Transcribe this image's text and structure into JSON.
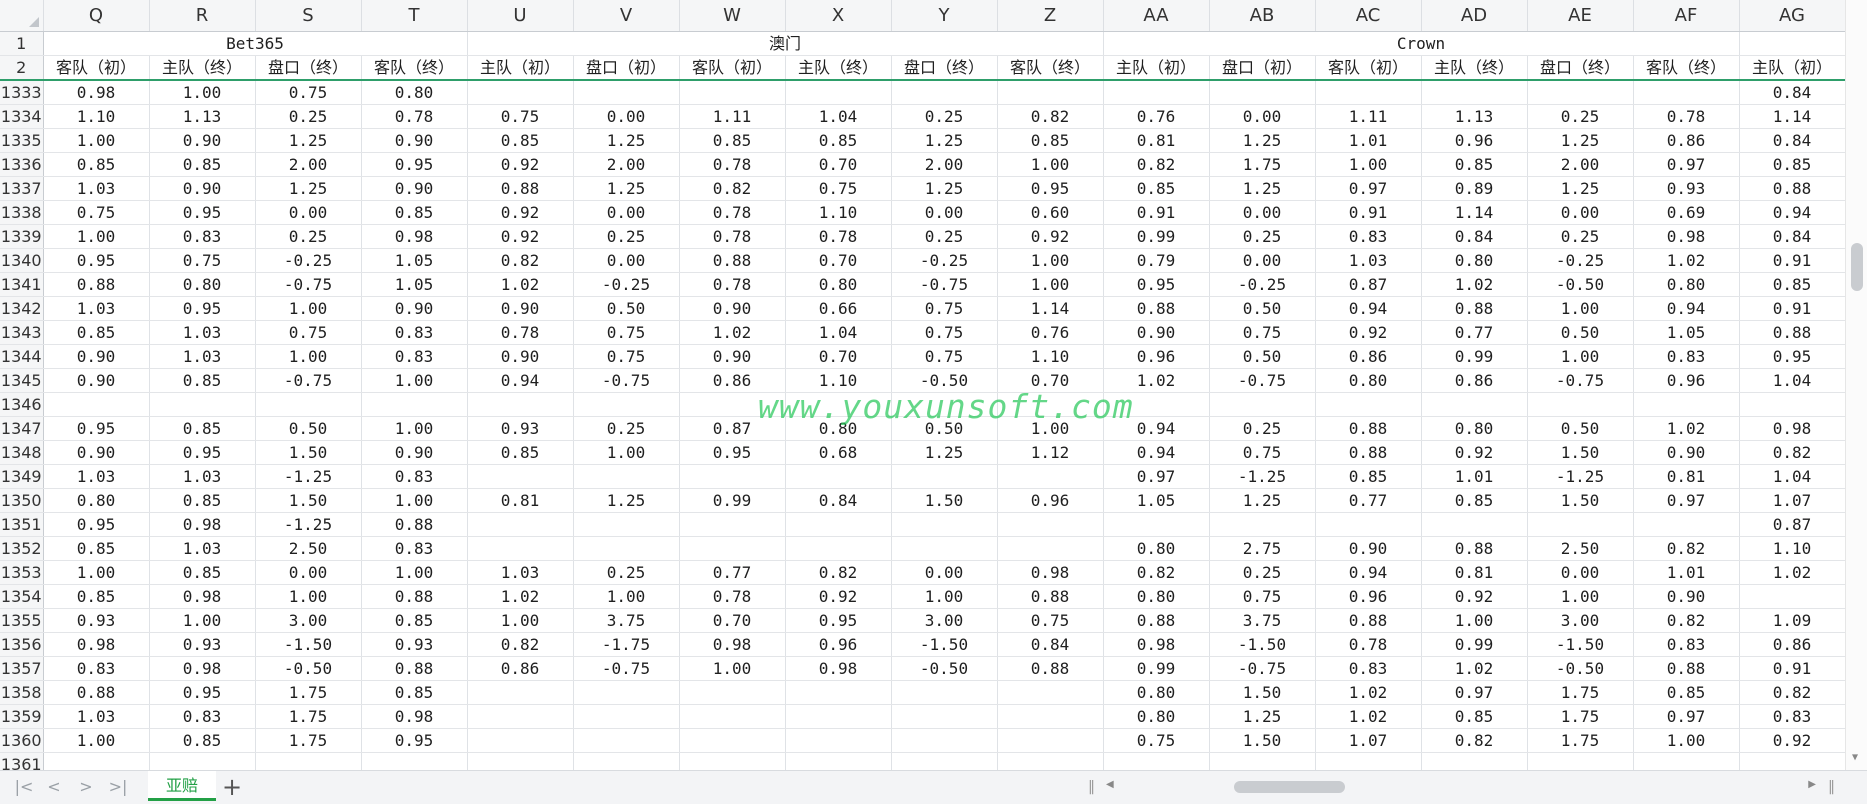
{
  "columns": [
    "Q",
    "R",
    "S",
    "T",
    "U",
    "V",
    "W",
    "X",
    "Y",
    "Z",
    "AA",
    "AB",
    "AC",
    "AD",
    "AE",
    "AF",
    "AG"
  ],
  "group_headers": [
    {
      "label": "Bet365",
      "span": 4
    },
    {
      "label": "澳门",
      "span": 6
    },
    {
      "label": "Crown",
      "span": 6
    },
    {
      "label": "",
      "span": 1
    }
  ],
  "header_row_labels": [
    "1",
    "2"
  ],
  "subheaders": [
    "客队（初）",
    "主队（终）",
    "盘口（终）",
    "客队（终）",
    "主队（初）",
    "盘口（初）",
    "客队（初）",
    "主队（终）",
    "盘口（终）",
    "客队（终）",
    "主队（初）",
    "盘口（初）",
    "客队（初）",
    "主队（终）",
    "盘口（终）",
    "客队（终）",
    "主队（初）"
  ],
  "rows": [
    {
      "n": "1333",
      "c": [
        "0.98",
        "1.00",
        "0.75",
        "0.80",
        "",
        "",
        "",
        "",
        "",
        "",
        "",
        "",
        "",
        "",
        "",
        "",
        "0.84"
      ]
    },
    {
      "n": "1334",
      "c": [
        "1.10",
        "1.13",
        "0.25",
        "0.78",
        "0.75",
        "0.00",
        "1.11",
        "1.04",
        "0.25",
        "0.82",
        "0.76",
        "0.00",
        "1.11",
        "1.13",
        "0.25",
        "0.78",
        "1.14"
      ]
    },
    {
      "n": "1335",
      "c": [
        "1.00",
        "0.90",
        "1.25",
        "0.90",
        "0.85",
        "1.25",
        "0.85",
        "0.85",
        "1.25",
        "0.85",
        "0.81",
        "1.25",
        "1.01",
        "0.96",
        "1.25",
        "0.86",
        "0.84"
      ]
    },
    {
      "n": "1336",
      "c": [
        "0.85",
        "0.85",
        "2.00",
        "0.95",
        "0.92",
        "2.00",
        "0.78",
        "0.70",
        "2.00",
        "1.00",
        "0.82",
        "1.75",
        "1.00",
        "0.85",
        "2.00",
        "0.97",
        "0.85"
      ]
    },
    {
      "n": "1337",
      "c": [
        "1.03",
        "0.90",
        "1.25",
        "0.90",
        "0.88",
        "1.25",
        "0.82",
        "0.75",
        "1.25",
        "0.95",
        "0.85",
        "1.25",
        "0.97",
        "0.89",
        "1.25",
        "0.93",
        "0.88"
      ]
    },
    {
      "n": "1338",
      "c": [
        "0.75",
        "0.95",
        "0.00",
        "0.85",
        "0.92",
        "0.00",
        "0.78",
        "1.10",
        "0.00",
        "0.60",
        "0.91",
        "0.00",
        "0.91",
        "1.14",
        "0.00",
        "0.69",
        "0.94"
      ]
    },
    {
      "n": "1339",
      "c": [
        "1.00",
        "0.83",
        "0.25",
        "0.98",
        "0.92",
        "0.25",
        "0.78",
        "0.78",
        "0.25",
        "0.92",
        "0.99",
        "0.25",
        "0.83",
        "0.84",
        "0.25",
        "0.98",
        "0.84"
      ]
    },
    {
      "n": "1340",
      "c": [
        "0.95",
        "0.75",
        "-0.25",
        "1.05",
        "0.82",
        "0.00",
        "0.88",
        "0.70",
        "-0.25",
        "1.00",
        "0.79",
        "0.00",
        "1.03",
        "0.80",
        "-0.25",
        "1.02",
        "0.91"
      ]
    },
    {
      "n": "1341",
      "c": [
        "0.88",
        "0.80",
        "-0.75",
        "1.05",
        "1.02",
        "-0.25",
        "0.78",
        "0.80",
        "-0.75",
        "1.00",
        "0.95",
        "-0.25",
        "0.87",
        "1.02",
        "-0.50",
        "0.80",
        "0.85"
      ]
    },
    {
      "n": "1342",
      "c": [
        "1.03",
        "0.95",
        "1.00",
        "0.90",
        "0.90",
        "0.50",
        "0.90",
        "0.66",
        "0.75",
        "1.14",
        "0.88",
        "0.50",
        "0.94",
        "0.88",
        "1.00",
        "0.94",
        "0.91"
      ]
    },
    {
      "n": "1343",
      "c": [
        "0.85",
        "1.03",
        "0.75",
        "0.83",
        "0.78",
        "0.75",
        "1.02",
        "1.04",
        "0.75",
        "0.76",
        "0.90",
        "0.75",
        "0.92",
        "0.77",
        "0.50",
        "1.05",
        "0.88"
      ]
    },
    {
      "n": "1344",
      "c": [
        "0.90",
        "1.03",
        "1.00",
        "0.83",
        "0.90",
        "0.75",
        "0.90",
        "0.70",
        "0.75",
        "1.10",
        "0.96",
        "0.50",
        "0.86",
        "0.99",
        "1.00",
        "0.83",
        "0.95"
      ]
    },
    {
      "n": "1345",
      "c": [
        "0.90",
        "0.85",
        "-0.75",
        "1.00",
        "0.94",
        "-0.75",
        "0.86",
        "1.10",
        "-0.50",
        "0.70",
        "1.02",
        "-0.75",
        "0.80",
        "0.86",
        "-0.75",
        "0.96",
        "1.04"
      ]
    },
    {
      "n": "1346",
      "c": [
        "",
        "",
        "",
        "",
        "",
        "",
        "",
        "",
        "",
        "",
        "",
        "",
        "",
        "",
        "",
        "",
        ""
      ]
    },
    {
      "n": "1347",
      "c": [
        "0.95",
        "0.85",
        "0.50",
        "1.00",
        "0.93",
        "0.25",
        "0.87",
        "0.80",
        "0.50",
        "1.00",
        "0.94",
        "0.25",
        "0.88",
        "0.80",
        "0.50",
        "1.02",
        "0.98"
      ]
    },
    {
      "n": "1348",
      "c": [
        "0.90",
        "0.95",
        "1.50",
        "0.90",
        "0.85",
        "1.00",
        "0.95",
        "0.68",
        "1.25",
        "1.12",
        "0.94",
        "0.75",
        "0.88",
        "0.92",
        "1.50",
        "0.90",
        "0.82"
      ]
    },
    {
      "n": "1349",
      "c": [
        "1.03",
        "1.03",
        "-1.25",
        "0.83",
        "",
        "",
        "",
        "",
        "",
        "",
        "0.97",
        "-1.25",
        "0.85",
        "1.01",
        "-1.25",
        "0.81",
        "1.04"
      ]
    },
    {
      "n": "1350",
      "c": [
        "0.80",
        "0.85",
        "1.50",
        "1.00",
        "0.81",
        "1.25",
        "0.99",
        "0.84",
        "1.50",
        "0.96",
        "1.05",
        "1.25",
        "0.77",
        "0.85",
        "1.50",
        "0.97",
        "1.07"
      ]
    },
    {
      "n": "1351",
      "c": [
        "0.95",
        "0.98",
        "-1.25",
        "0.88",
        "",
        "",
        "",
        "",
        "",
        "",
        "",
        "",
        "",
        "",
        "",
        "",
        "0.87"
      ]
    },
    {
      "n": "1352",
      "c": [
        "0.85",
        "1.03",
        "2.50",
        "0.83",
        "",
        "",
        "",
        "",
        "",
        "",
        "0.80",
        "2.75",
        "0.90",
        "0.88",
        "2.50",
        "0.82",
        "1.10"
      ]
    },
    {
      "n": "1353",
      "c": [
        "1.00",
        "0.85",
        "0.00",
        "1.00",
        "1.03",
        "0.25",
        "0.77",
        "0.82",
        "0.00",
        "0.98",
        "0.82",
        "0.25",
        "0.94",
        "0.81",
        "0.00",
        "1.01",
        "1.02"
      ]
    },
    {
      "n": "1354",
      "c": [
        "0.85",
        "0.98",
        "1.00",
        "0.88",
        "1.02",
        "1.00",
        "0.78",
        "0.92",
        "1.00",
        "0.88",
        "0.80",
        "0.75",
        "0.96",
        "0.92",
        "1.00",
        "0.90",
        ""
      ]
    },
    {
      "n": "1355",
      "c": [
        "0.93",
        "1.00",
        "3.00",
        "0.85",
        "1.00",
        "3.75",
        "0.70",
        "0.95",
        "3.00",
        "0.75",
        "0.88",
        "3.75",
        "0.88",
        "1.00",
        "3.00",
        "0.82",
        "1.09"
      ]
    },
    {
      "n": "1356",
      "c": [
        "0.98",
        "0.93",
        "-1.50",
        "0.93",
        "0.82",
        "-1.75",
        "0.98",
        "0.96",
        "-1.50",
        "0.84",
        "0.98",
        "-1.50",
        "0.78",
        "0.99",
        "-1.50",
        "0.83",
        "0.86"
      ]
    },
    {
      "n": "1357",
      "c": [
        "0.83",
        "0.98",
        "-0.50",
        "0.88",
        "0.86",
        "-0.75",
        "1.00",
        "0.98",
        "-0.50",
        "0.88",
        "0.99",
        "-0.75",
        "0.83",
        "1.02",
        "-0.50",
        "0.88",
        "0.91"
      ]
    },
    {
      "n": "1358",
      "c": [
        "0.88",
        "0.95",
        "1.75",
        "0.85",
        "",
        "",
        "",
        "",
        "",
        "",
        "0.80",
        "1.50",
        "1.02",
        "0.97",
        "1.75",
        "0.85",
        "0.82"
      ]
    },
    {
      "n": "1359",
      "c": [
        "1.03",
        "0.83",
        "1.75",
        "0.98",
        "",
        "",
        "",
        "",
        "",
        "",
        "0.80",
        "1.25",
        "1.02",
        "0.85",
        "1.75",
        "0.97",
        "0.83"
      ]
    },
    {
      "n": "1360",
      "c": [
        "1.00",
        "0.85",
        "1.75",
        "0.95",
        "",
        "",
        "",
        "",
        "",
        "",
        "0.75",
        "1.50",
        "1.07",
        "0.82",
        "1.75",
        "1.00",
        "0.92"
      ]
    },
    {
      "n": "1361",
      "c": [
        "",
        "",
        "",
        "",
        "",
        "",
        "",
        "",
        "",
        "",
        "",
        "",
        "",
        "",
        "",
        "",
        ""
      ]
    }
  ],
  "watermark": "www.youxunsoft.com",
  "sheet_tab": "亚赔",
  "add_sheet_label": "+",
  "nav": {
    "first": "|<",
    "prev": "<",
    "next": ">",
    "last": ">|"
  },
  "colors": {
    "accent": "#23a046",
    "freeze_line": "#2e9e6a",
    "watermark": "#28c85a"
  }
}
